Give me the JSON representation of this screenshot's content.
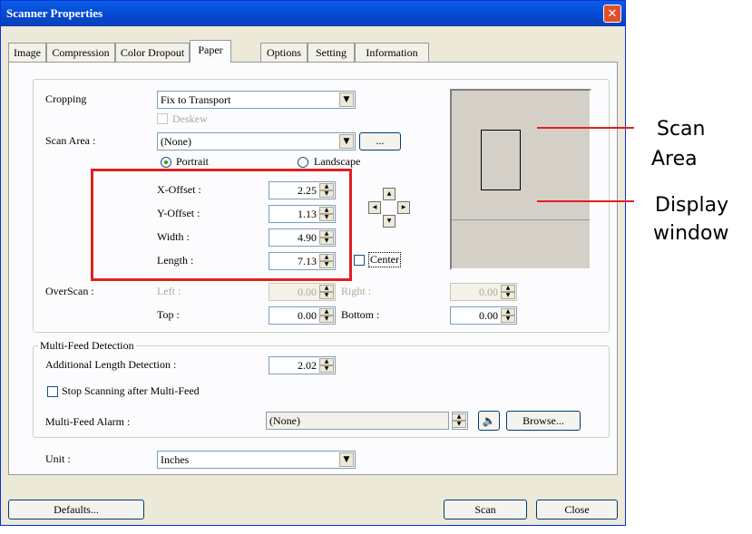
{
  "window": {
    "title": "Scanner Properties",
    "close_symbol": "✕"
  },
  "tabs": [
    {
      "label": "Image"
    },
    {
      "label": "Compression"
    },
    {
      "label": "Color Dropout"
    },
    {
      "label": "Paper",
      "active": true
    },
    {
      "label": "Options"
    },
    {
      "label": "Setting"
    },
    {
      "label": "Information"
    }
  ],
  "paper": {
    "cropping_label": "Cropping",
    "cropping_value": "Fix to Transport",
    "deskew_label": "Deskew",
    "deskew_checked": false,
    "scan_area_label": "Scan Area :",
    "scan_area_value": "(None)",
    "browse_small_label": "...",
    "portrait_label": "Portrait",
    "landscape_label": "Landscape",
    "orientation_selected": "Portrait",
    "x_offset_label": "X-Offset :",
    "x_offset_value": "2.25",
    "y_offset_label": "Y-Offset :",
    "y_offset_value": "1.13",
    "width_label": "Width :",
    "width_value": "4.90",
    "length_label": "Length :",
    "length_value": "7.13",
    "center_label": "Center",
    "center_checked": false,
    "overscan_label": "OverScan :",
    "left_label": "Left :",
    "left_value": "0.00",
    "right_label": "Right :",
    "right_value": "0.00",
    "top_label": "Top :",
    "top_value": "0.00",
    "bottom_label": "Bottom :",
    "bottom_value": "0.00"
  },
  "multifeed": {
    "group_label": "Multi-Feed Detection",
    "additional_length_label": "Additional Length Detection :",
    "additional_length_value": "2.02",
    "stop_scanning_label": "Stop Scanning after Multi-Feed",
    "stop_scanning_checked": false,
    "alarm_label": "Multi-Feed Alarm :",
    "alarm_value": "(None)",
    "speaker_symbol": "🔈",
    "browse_label": "Browse..."
  },
  "unit": {
    "label": "Unit :",
    "value": "Inches"
  },
  "footer": {
    "defaults_label": "Defaults...",
    "scan_label": "Scan",
    "close_label": "Close"
  },
  "callouts": {
    "scan_area_line1": "Scan",
    "scan_area_line2": "Area",
    "display_line1": "Display",
    "display_line2": "window"
  },
  "colors": {
    "highlight_box": "#e02020",
    "titlebar": "#0a5ee6"
  },
  "icons": {
    "dropdown": "chevron-down-icon",
    "spin_up": "spin-up-icon",
    "spin_down": "spin-down-icon",
    "speaker": "speaker-icon",
    "close": "close-icon"
  }
}
